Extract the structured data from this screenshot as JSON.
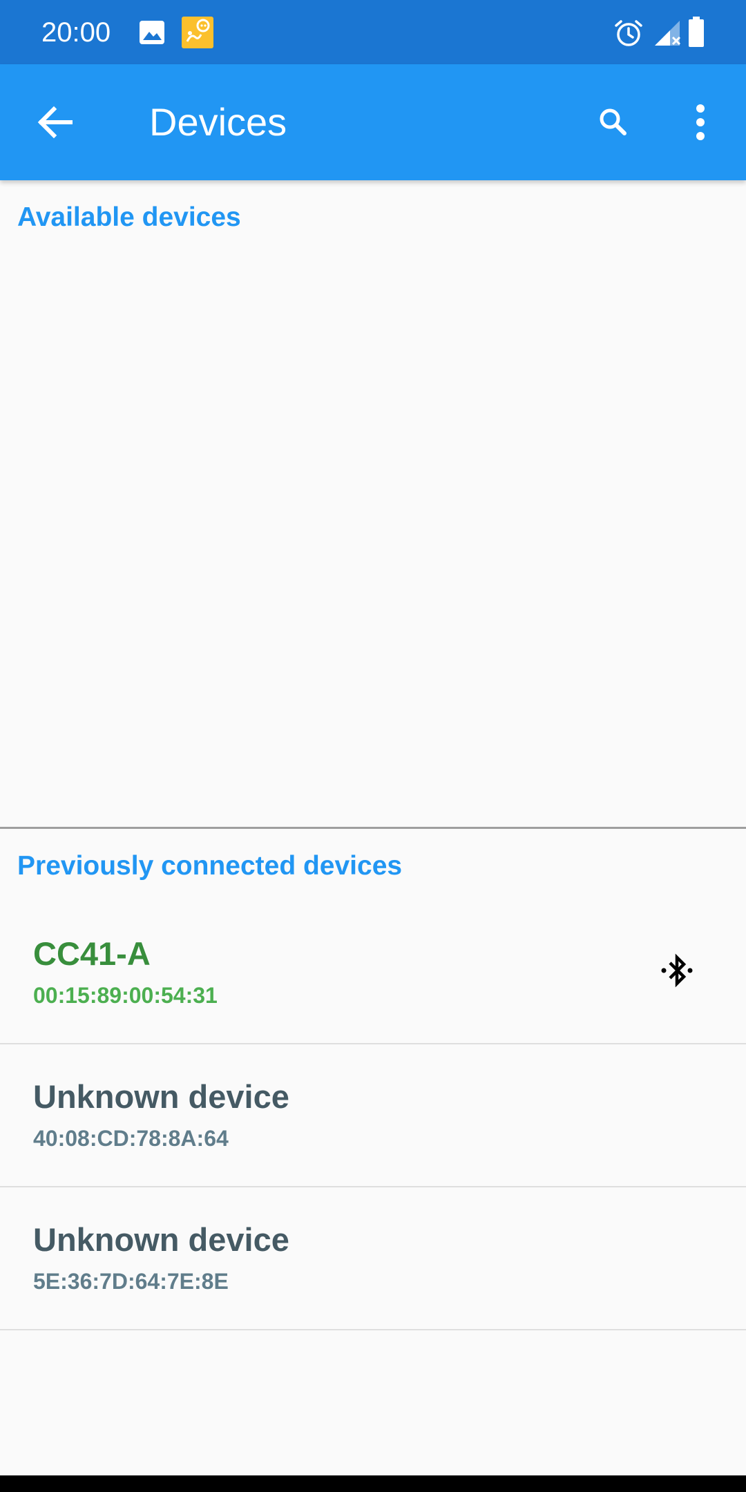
{
  "status_bar": {
    "time": "20:00",
    "icons": [
      "image-icon",
      "app-notification-icon",
      "alarm-icon",
      "signal-icon",
      "battery-icon"
    ],
    "background": "#1b76d2"
  },
  "app_bar": {
    "title": "Devices",
    "background": "#2196f3",
    "icons": [
      "back-arrow-icon",
      "search-icon",
      "more-vert-icon"
    ]
  },
  "sections": {
    "available": {
      "header": "Available devices"
    },
    "previous": {
      "header": "Previously connected devices",
      "devices": [
        {
          "name": "CC41-A",
          "address": "00:15:89:00:54:31",
          "connected": true,
          "icon": "bluetooth-connected-icon"
        },
        {
          "name": "Unknown device",
          "address": "40:08:CD:78:8A:64",
          "connected": false
        },
        {
          "name": "Unknown device",
          "address": "5E:36:7D:64:7E:8E",
          "connected": false
        }
      ]
    }
  },
  "colors": {
    "accent": "#2196f3",
    "connected_name": "#388e3c",
    "connected_address": "#4caf50",
    "device_name": "#455a64",
    "device_address": "#607d8b"
  }
}
